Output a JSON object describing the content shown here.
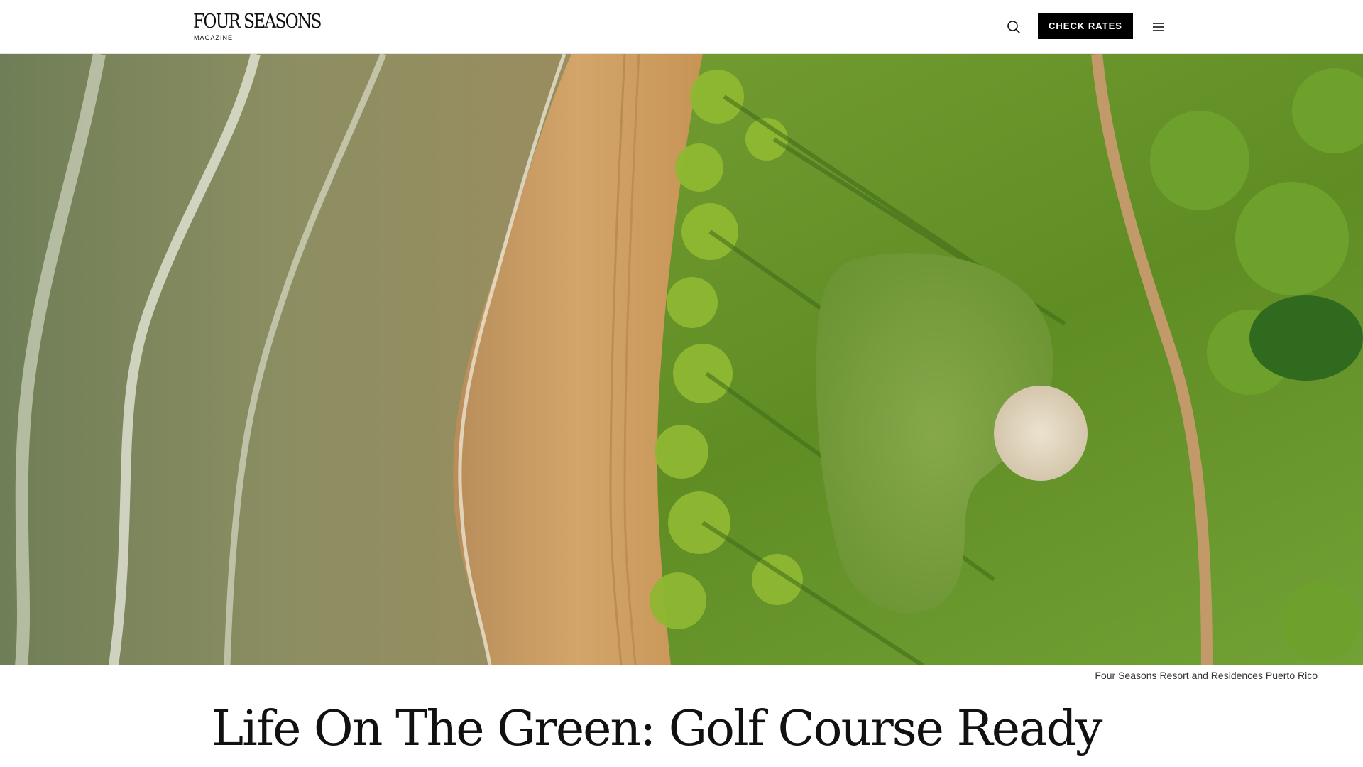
{
  "header": {
    "logo": {
      "main": "FOUR SEASONS",
      "sub": "MAGAZINE"
    },
    "search_icon": "search-icon",
    "check_rates_label": "CHECK RATES",
    "menu_icon": "hamburger-menu-icon"
  },
  "hero": {
    "image_caption": "Four Seasons Resort and Residences Puerto Rico"
  },
  "article": {
    "title": "Life On The Green: Golf Course Ready"
  },
  "colors": {
    "header_bg": "#ffffff",
    "button_bg": "#000000",
    "button_text": "#ffffff",
    "ocean": "#7f8a5e",
    "sand": "#c9995c",
    "grass": "#6f9a2c"
  }
}
